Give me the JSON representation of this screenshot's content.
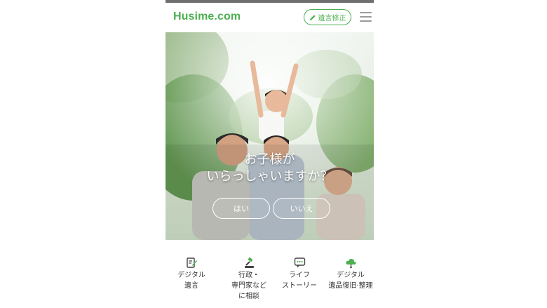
{
  "header": {
    "logo": "Husime.com",
    "edit_label": "遺言修正",
    "edit_icon": "pencil-icon",
    "menu_icon": "hamburger-menu-icon"
  },
  "hero": {
    "question_line1": "お子様が",
    "question_line2": "いらっしゃいますか？",
    "yes_label": "はい",
    "no_label": "いいえ"
  },
  "nav": {
    "items": [
      {
        "label": "デジタル\n遺言",
        "icon": "document-edit-icon"
      },
      {
        "label": "行政・\n専門家など\nに相談",
        "icon": "gavel-icon"
      },
      {
        "label": "ライフ\nストーリー",
        "icon": "chat-bubble-icon"
      },
      {
        "label": "デジタル\n遺品復旧·整理",
        "icon": "cloud-icon"
      }
    ]
  },
  "colors": {
    "brand": "#4caf50",
    "text": "#333333"
  }
}
